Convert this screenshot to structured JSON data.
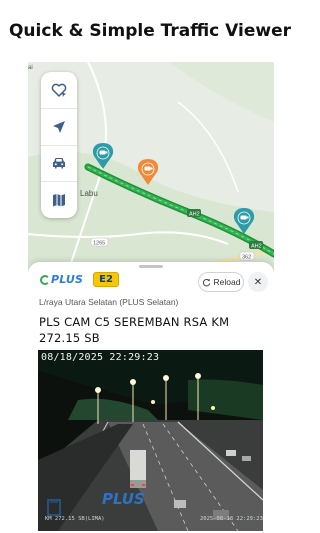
{
  "headline": "Quick & Simple Traffic Viewer",
  "map": {
    "place_label": "Labu",
    "route_shields": [
      "AH2",
      "AH2"
    ],
    "road_numbers": [
      "1265",
      "362"
    ],
    "corner_text": "ai"
  },
  "toolbar": {
    "icons": [
      "favorite-location-icon",
      "navigation-arrow-icon",
      "car-icon",
      "map-icon"
    ]
  },
  "sheet": {
    "brand_text": "PLUS",
    "route_code": "E2",
    "reload_label": "Reload",
    "close_glyph": "✕",
    "road_name": "L/raya Utara Selatan (PLUS Selatan)",
    "camera_title": "PLS CAM C5 SEREMBAN RSA KM 272.15 SB"
  },
  "feed": {
    "timestamp": "08/18/2025 22:29:23",
    "overlay_label": "KM 272.15 SB(LIMA)",
    "overlay_date": "2025-08-18 22:29:23",
    "watermark": "PLUS"
  },
  "colors": {
    "highway_green": "#27a847",
    "camera_pin_teal": "#2e9ba8",
    "camera_pin_orange": "#f08a3a",
    "accent_blue": "#2a7de1"
  }
}
